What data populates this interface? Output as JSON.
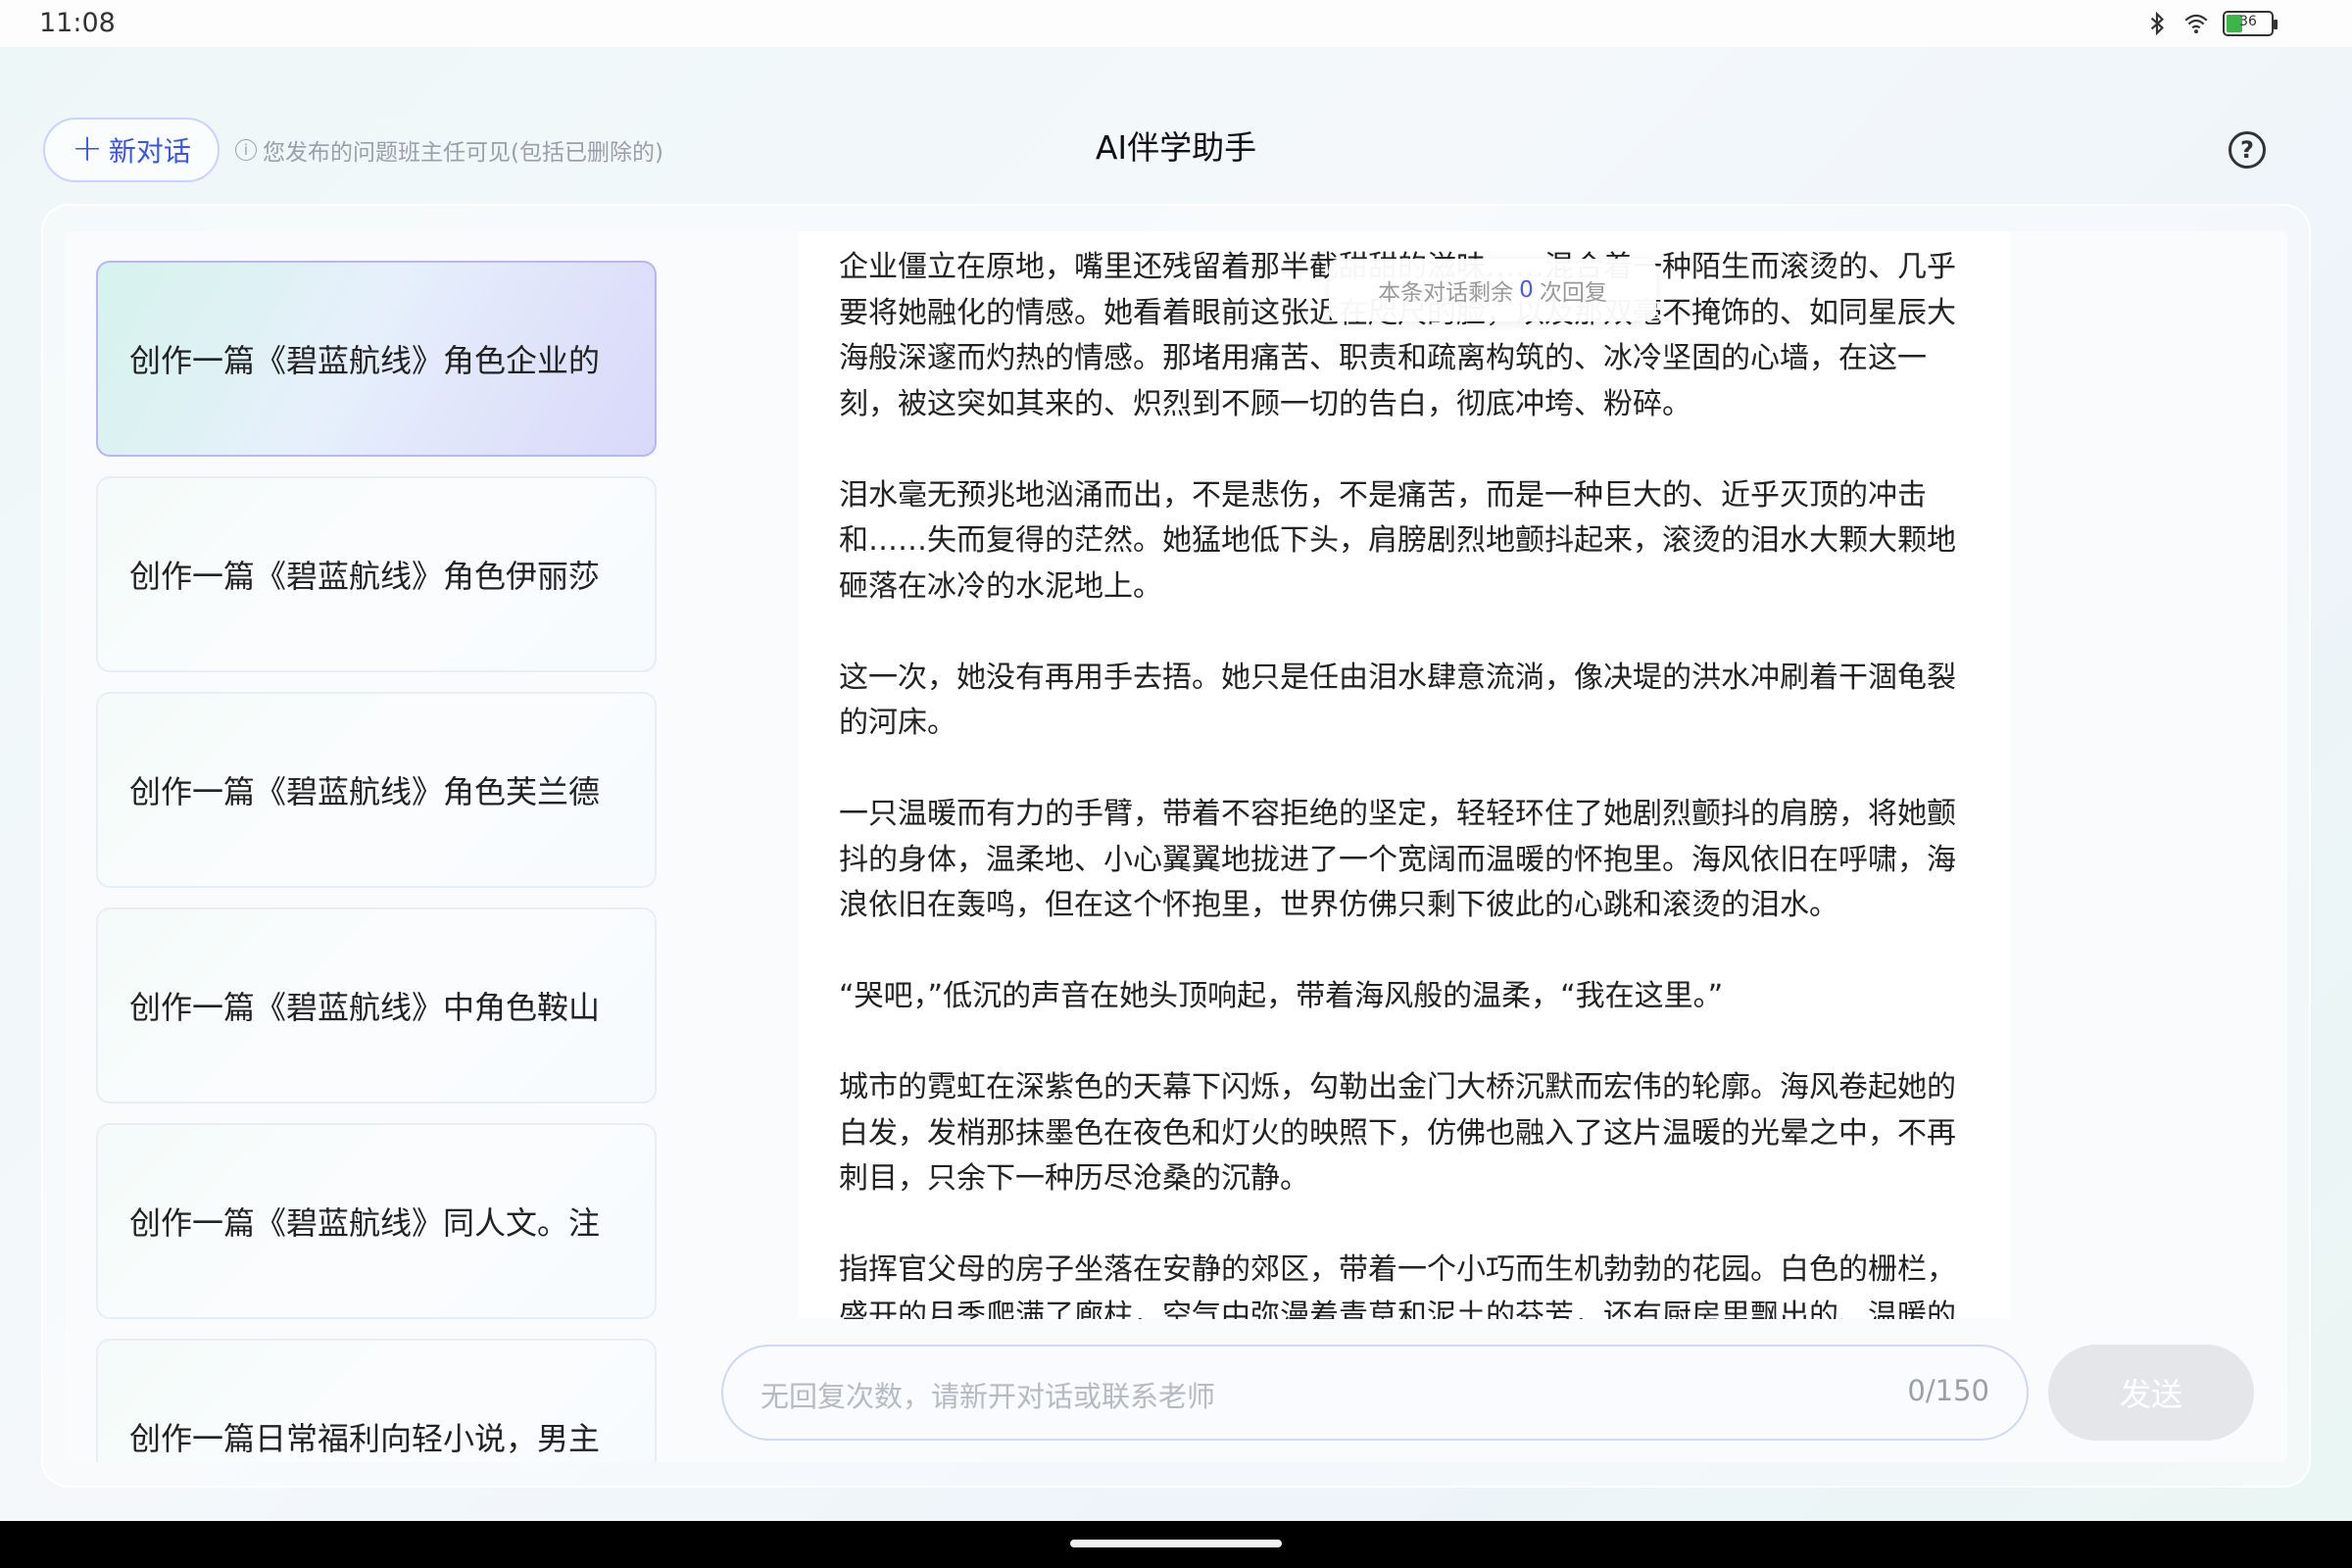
{
  "status_bar": {
    "time": "11:08",
    "battery": "36",
    "battery_level": 0.36
  },
  "header": {
    "new_chat_label": "新对话",
    "notice": "您发布的问题班主任可见(包括已删除的)",
    "title": "AI伴学助手"
  },
  "sidebar": {
    "items": [
      {
        "label": "创作一篇《碧蓝航线》角色企业的",
        "active": true
      },
      {
        "label": "创作一篇《碧蓝航线》角色伊丽莎",
        "active": false
      },
      {
        "label": "创作一篇《碧蓝航线》角色芙兰德",
        "active": false
      },
      {
        "label": "创作一篇《碧蓝航线》中角色鞍山",
        "active": false
      },
      {
        "label": "创作一篇《碧蓝航线》同人文。注",
        "active": false
      },
      {
        "label": "创作一篇日常福利向轻小说，男主",
        "active": false
      }
    ]
  },
  "toast": {
    "prefix": "本条对话剩余",
    "count": "0",
    "suffix": "次回复"
  },
  "chat": {
    "paragraphs": [
      "企业僵立在原地，嘴里还残留着那半截甜甜的滋味……混合着一种陌生而滚烫的、几乎要将她融化的情感。她看着眼前这张近在咫尺的脸，以及那双毫不掩饰的、如同星辰大海般深邃而灼热的情感。那堵用痛苦、职责和疏离构筑的、冰冷坚固的心墙，在这一刻，被这突如其来的、炽烈到不顾一切的告白，彻底冲垮、粉碎。",
      "泪水毫无预兆地汹涌而出，不是悲伤，不是痛苦，而是一种巨大的、近乎灭顶的冲击和……失而复得的茫然。她猛地低下头，肩膀剧烈地颤抖起来，滚烫的泪水大颗大颗地砸落在冰冷的水泥地上。",
      "这一次，她没有再用手去捂。她只是任由泪水肆意流淌，像决堤的洪水冲刷着干涸龟裂的河床。",
      "一只温暖而有力的手臂，带着不容拒绝的坚定，轻轻环住了她剧烈颤抖的肩膀，将她颤抖的身体，温柔地、小心翼翼地拢进了一个宽阔而温暖的怀抱里。海风依旧在呼啸，海浪依旧在轰鸣，但在这个怀抱里，世界仿佛只剩下彼此的心跳和滚烫的泪水。",
      "“哭吧，”低沉的声音在她头顶响起，带着海风般的温柔，“我在这里。”",
      "城市的霓虹在深紫色的天幕下闪烁，勾勒出金门大桥沉默而宏伟的轮廓。海风卷起她的白发，发梢那抹墨色在夜色和灯火的映照下，仿佛也融入了这片温暖的光晕之中，不再刺目，只余下一种历尽沧桑的沉静。",
      "指挥官父母的房子坐落在安静的郊区，带着一个小巧而生机勃勃的花园。白色的栅栏，盛开的月季爬满了廊柱，空气中弥漫着青草和泥土的芬芳，还有厨房里飘出的、温暖的"
    ]
  },
  "composer": {
    "placeholder": "无回复次数，请新开对话或联系老师",
    "counter": "0/150",
    "send_label": "发送"
  }
}
